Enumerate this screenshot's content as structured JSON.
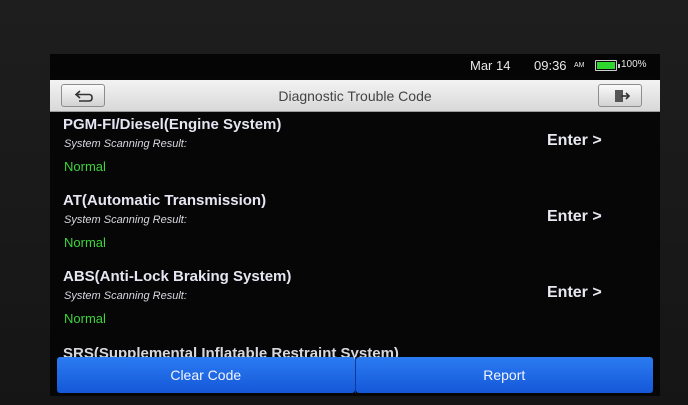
{
  "status": {
    "date": "Mar 14",
    "time": "09:36",
    "ampm": "AM",
    "battery_pct": "100%",
    "battery_level": 1.0,
    "battery_color": "#2fd62f"
  },
  "header": {
    "title": "Diagnostic Trouble Code",
    "back_icon": "back-arrow-icon",
    "exit_icon": "exit-icon"
  },
  "systems": [
    {
      "name": "PGM-FI/Diesel(Engine System)",
      "result_label": "System Scanning Result:",
      "result": "Normal",
      "action": "Enter >"
    },
    {
      "name": "AT(Automatic Transmission)",
      "result_label": "System Scanning Result:",
      "result": "Normal",
      "action": "Enter >"
    },
    {
      "name": "ABS(Anti-Lock Braking System)",
      "result_label": "System Scanning Result:",
      "result": "Normal",
      "action": "Enter >"
    }
  ],
  "partial_item": "SRS(Supplemental Inflatable Restraint System)",
  "footer": {
    "clear_label": "Clear Code",
    "report_label": "Report"
  },
  "colors": {
    "accent_blue": "#1f6ae8",
    "normal_green": "#3dd43d"
  }
}
